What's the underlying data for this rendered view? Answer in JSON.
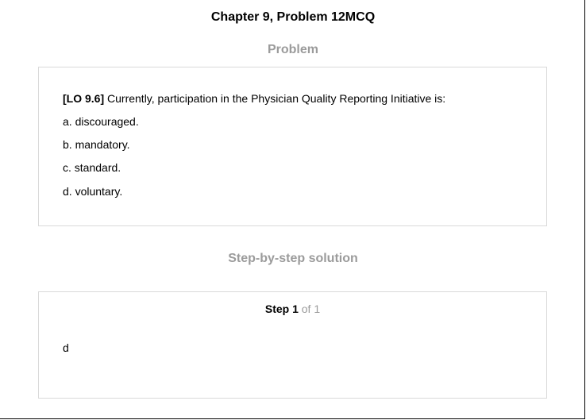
{
  "header": {
    "title": "Chapter 9, Problem 12MCQ"
  },
  "problem": {
    "heading": "Problem",
    "lo_tag": "[LO 9.6]",
    "question": " Currently, participation in the Physician Quality Reporting Initiative is:",
    "options": [
      "a. discouraged.",
      "b. mandatory.",
      "c. standard.",
      "d. voluntary."
    ]
  },
  "solution": {
    "heading": "Step-by-step solution",
    "step_label": "Step 1",
    "step_of": " of 1",
    "answer": "d"
  }
}
